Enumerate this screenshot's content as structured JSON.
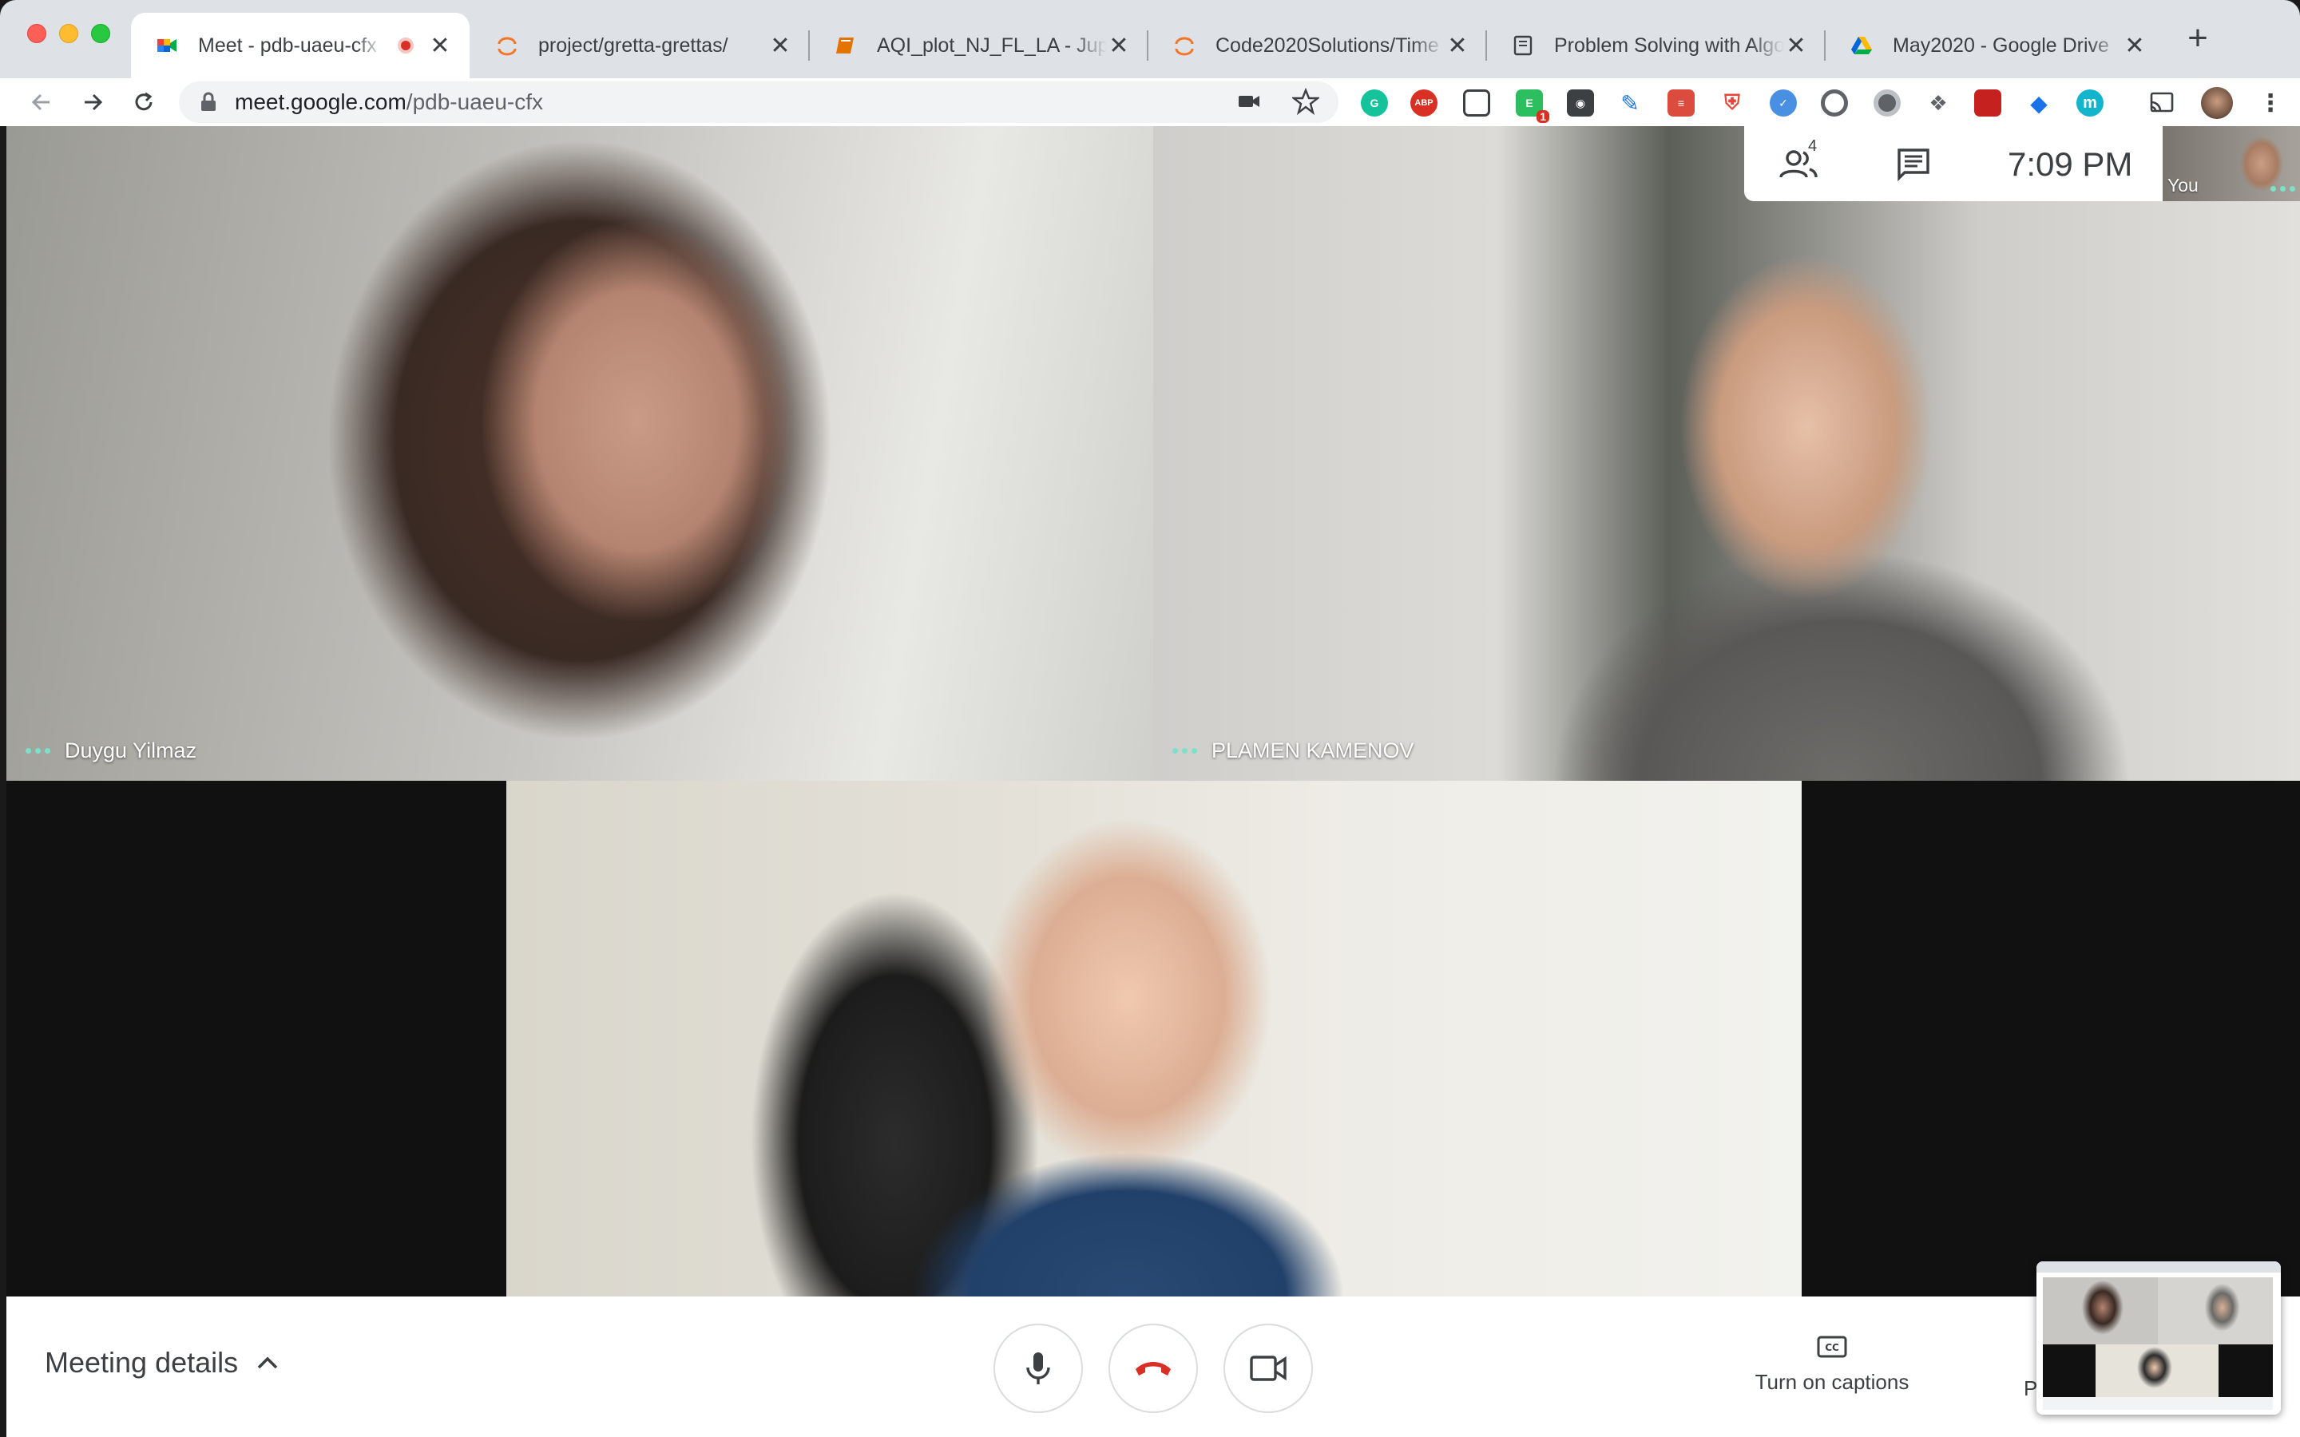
{
  "browser": {
    "tabs": [
      {
        "title": "Meet - pdb-uaeu-cfx",
        "favicon": "google-meet-icon",
        "recording": true,
        "active": true
      },
      {
        "title": "project/gretta-grettas/",
        "favicon": "jupyter-icon"
      },
      {
        "title": "AQI_plot_NJ_FL_LA - Jupy",
        "favicon": "notebook-icon"
      },
      {
        "title": "Code2020Solutions/Time",
        "favicon": "jupyter-icon"
      },
      {
        "title": "Problem Solving with Algo",
        "favicon": "book-icon"
      },
      {
        "title": "May2020 - Google Drive",
        "favicon": "google-drive-icon"
      }
    ],
    "url_host": "meet.google.com",
    "url_path": "/pdb-uaeu-cfx",
    "extensions": [
      "grammarly-icon",
      "adblock-plus-icon",
      "pocket-icon",
      "evernote-icon",
      "lastpass-icon",
      "pen-icon",
      "todoist-icon",
      "shield-icon",
      "task-icon",
      "loop-icon",
      "circle-icon",
      "dropbox-icon",
      "bookmark-icon",
      "graduation-cap-icon",
      "m-icon",
      "cast-icon",
      "profile-avatar",
      "more-vert-icon"
    ],
    "extension_badge": "1"
  },
  "meeting": {
    "participants": [
      {
        "name": "Duygu Yilmaz"
      },
      {
        "name": "PLAMEN KAMENOV"
      }
    ],
    "people_count": "4",
    "time": "7:09 PM",
    "self_label": "You"
  },
  "controls": {
    "meeting_details": "Meeting details",
    "captions": "Turn on captions",
    "present_initial": "P"
  },
  "colors": {
    "accent_teal": "#7de0c9",
    "end_call_red": "#d93025",
    "tab_strip": "#dee1e6"
  }
}
